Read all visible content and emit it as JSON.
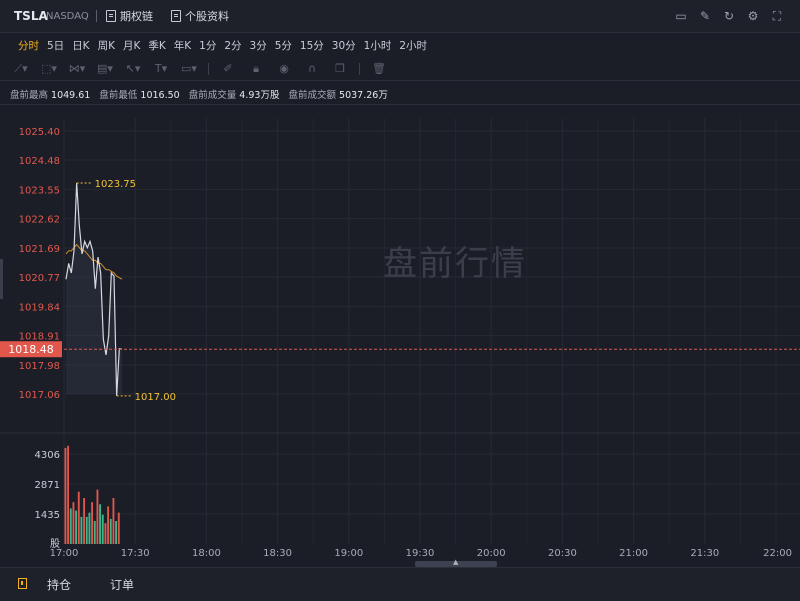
{
  "header": {
    "symbol": "TSLA",
    "exchange": "NASDAQ",
    "options_label": "期权链",
    "profile_label": "个股资料",
    "icons": [
      "chart-settings-icon",
      "edit-icon",
      "refresh-icon",
      "gear-icon",
      "fullscreen-icon"
    ]
  },
  "periods": [
    "分时",
    "5日",
    "日K",
    "周K",
    "月K",
    "季K",
    "年K",
    "1分",
    "2分",
    "3分",
    "5分",
    "15分",
    "30分",
    "1小时",
    "2小时"
  ],
  "active_period": "分时",
  "stats": {
    "high_label": "盘前最高",
    "high": "1049.61",
    "low_label": "盘前最低",
    "low": "1016.50",
    "vol_label": "盘前成交量",
    "vol": "4.93万股",
    "amt_label": "盘前成交额",
    "amt": "5037.26万"
  },
  "watermark": "盘前行情",
  "colors": {
    "up": "#e2574c",
    "down": "#3fb68b",
    "accent": "#f2b01e",
    "price_line": "#d6d9e0",
    "avg_line": "#d98e2b"
  },
  "chart_data": {
    "type": "line",
    "price_axis": [
      "1025.40",
      "1024.48",
      "1023.55",
      "1022.62",
      "1021.69",
      "1020.77",
      "1019.84",
      "1018.91",
      "1017.98",
      "1017.06"
    ],
    "current_price": "1018.48",
    "high_callout": "1023.75",
    "low_callout": "1017.00",
    "volume_axis": [
      "4306",
      "2871",
      "1435"
    ],
    "volume_unit": "股",
    "x_ticks": [
      "17:00",
      "17:30",
      "18:00",
      "18:30",
      "19:00",
      "19:30",
      "20:00",
      "20:30",
      "21:00",
      "21:30",
      "22:00"
    ],
    "price": [
      1020.7,
      1021.2,
      1020.9,
      1021.6,
      1023.75,
      1022.4,
      1021.5,
      1021.9,
      1021.7,
      1021.9,
      1021.6,
      1020.4,
      1021.4,
      1020.9,
      1018.8,
      1018.3,
      1018.9,
      1020.9,
      1020.8,
      1017.0,
      1018.5,
      1018.48
    ],
    "avg": [
      1021.5,
      1021.6,
      1021.6,
      1021.7,
      1021.8,
      1021.7,
      1021.6,
      1021.6,
      1021.5,
      1021.4,
      1021.3,
      1021.3,
      1021.2,
      1021.2,
      1021.1,
      1021.0,
      1021.0,
      1020.95,
      1020.9,
      1020.8,
      1020.75,
      1020.7
    ],
    "volume": [
      4600,
      4700,
      1700,
      2000,
      1600,
      2500,
      1300,
      2200,
      1300,
      1500,
      2000,
      1100,
      2600,
      1900,
      1400,
      1000,
      1800,
      1200,
      2200,
      1100,
      1500
    ],
    "volume_up": [
      true,
      true,
      false,
      true,
      false,
      true,
      false,
      true,
      false,
      false,
      true,
      false,
      true,
      false,
      false,
      true,
      true,
      false,
      true,
      false,
      true
    ]
  },
  "bottom": {
    "positions": "持仓",
    "orders": "订单"
  }
}
